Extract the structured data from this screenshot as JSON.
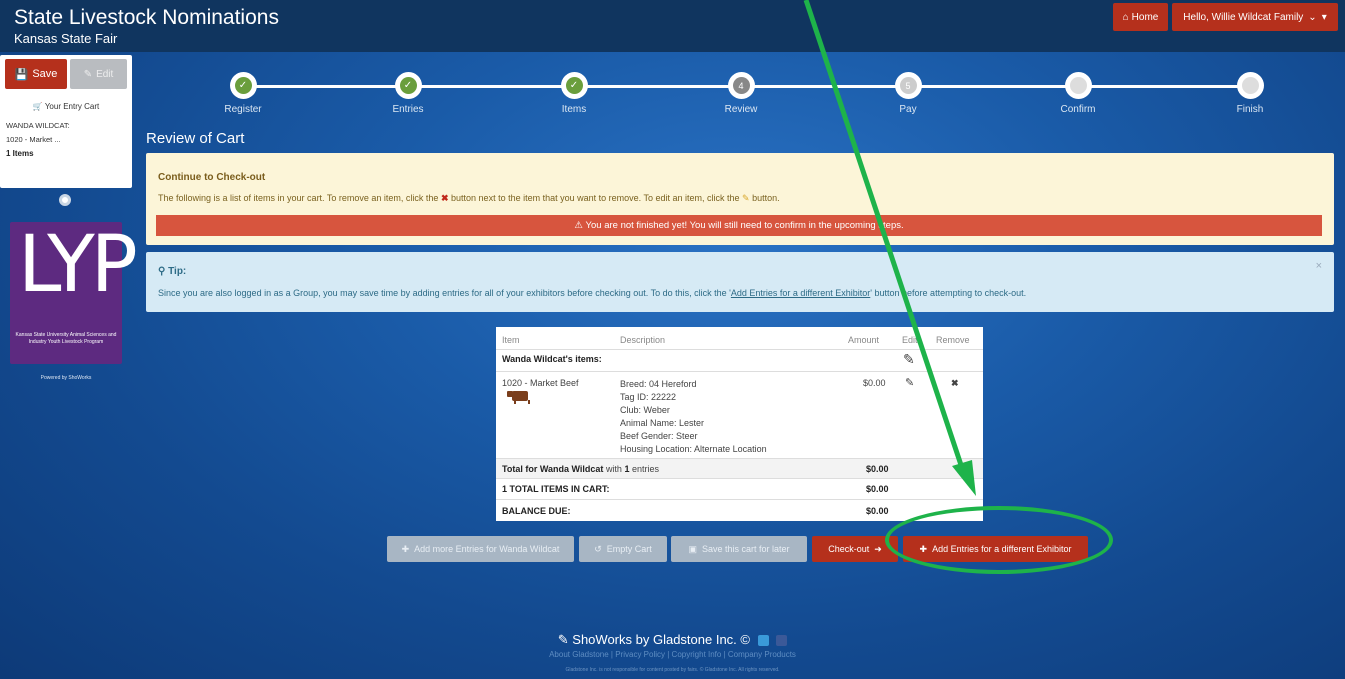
{
  "header": {
    "title": "State Livestock Nominations",
    "subtitle": "Kansas State Fair",
    "home_label": "Home",
    "user_label": "Hello, Willie Wildcat Family"
  },
  "cart_panel": {
    "save_label": "Save",
    "edit_label": "Edit",
    "title": "Your Entry Cart",
    "exhibitor": "WANDA WILDCAT:",
    "item": "1020 - Market ...",
    "count": "1 Items"
  },
  "logo": {
    "letters": "LYP",
    "caption": "Kansas State University Animal Sciences and Industry Youth Livestock Program",
    "powered_by": "Powered by ShoWorks"
  },
  "steps": [
    {
      "label": "Register",
      "state": "done"
    },
    {
      "label": "Entries",
      "state": "done"
    },
    {
      "label": "Items",
      "state": "done"
    },
    {
      "label": "Review",
      "state": "current",
      "num": "4"
    },
    {
      "label": "Pay",
      "state": "next",
      "num": "5"
    },
    {
      "label": "Confirm",
      "state": "future"
    },
    {
      "label": "Finish",
      "state": "future"
    }
  ],
  "page_title": "Review of Cart",
  "notice": {
    "heading": "Continue to Check-out",
    "body_1": "The following is a list of items in your cart. To remove an item, click the",
    "body_2": "button next to the item that you want to remove. To edit an item, click the",
    "body_3": "button.",
    "warning": "You are not finished yet! You will still need to confirm in the upcoming steps."
  },
  "tip": {
    "heading": "Tip:",
    "body_1": "Since you are also logged in as a Group, you may save time by adding entries for all of your exhibitors before checking out. To do this, click the '",
    "link": "Add Entries for a different Exhibitor",
    "body_2": "' button before attempting to check-out.",
    "close": "×"
  },
  "table": {
    "headers": {
      "item": "Item",
      "description": "Description",
      "amount": "Amount",
      "edit": "Edit",
      "remove": "Remove"
    },
    "group_label": "Wanda Wildcat's items:",
    "row": {
      "item": "1020 - Market Beef",
      "details": [
        "Breed: 04 Hereford",
        "Tag ID: 22222",
        "Club: Weber",
        "Animal Name: Lester",
        "Beef Gender: Steer",
        "Housing Location: Alternate Location"
      ],
      "amount": "$0.00"
    },
    "total_prefix": "Total for Wanda Wildcat",
    "total_mid": "with",
    "total_count": "1",
    "total_suffix": "entries",
    "total_amount": "$0.00",
    "items_in_cart": "1 TOTAL ITEMS IN CART:",
    "items_amount": "$0.00",
    "balance_label": "BALANCE DUE:",
    "balance_amount": "$0.00"
  },
  "buttons": {
    "add_more": "Add more Entries for Wanda Wildcat",
    "empty": "Empty Cart",
    "save_later": "Save this cart for later",
    "checkout": "Check-out",
    "add_different": "Add Entries for a different Exhibitor"
  },
  "footer": {
    "brand": "ShoWorks by Gladstone Inc. ©",
    "links": [
      "About Gladstone",
      "Privacy Policy",
      "Copyright Info",
      "Company Products"
    ],
    "legal": "Gladstone Inc. is not responsible for content posted by fairs. © Gladstone Inc. All rights reserved."
  },
  "colors": {
    "accent": "#b5301c",
    "highlight": "#1eb34a",
    "header": "#10355f"
  }
}
